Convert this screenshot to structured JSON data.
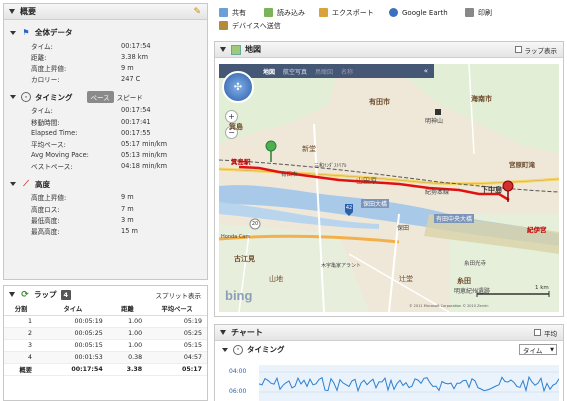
{
  "overview": {
    "title": "概要",
    "overall": {
      "title": "全体データ",
      "rows": [
        {
          "k": "タイム:",
          "v": "00:17:54"
        },
        {
          "k": "距離:",
          "v": "3.38 km"
        },
        {
          "k": "高度上昇値:",
          "v": "9 m"
        },
        {
          "k": "カロリー:",
          "v": "247 C"
        }
      ]
    },
    "timing": {
      "title": "タイミング",
      "pace_label": "ペース",
      "speed_label": "スピード",
      "rows": [
        {
          "k": "タイム:",
          "v": "00:17:54"
        },
        {
          "k": "移動時間:",
          "v": "00:17:41"
        },
        {
          "k": "Elapsed Time:",
          "v": "00:17:55"
        },
        {
          "k": "平均ペース:",
          "v": "05:17 min/km"
        },
        {
          "k": "Avg Moving Pace:",
          "v": "05:13 min/km"
        },
        {
          "k": "ベストペース:",
          "v": "04:18 min/km"
        }
      ]
    },
    "elevation": {
      "title": "高度",
      "rows": [
        {
          "k": "高度上昇値:",
          "v": "9 m"
        },
        {
          "k": "高度ロス:",
          "v": "7 m"
        },
        {
          "k": "最低高度:",
          "v": "3 m"
        },
        {
          "k": "最高高度:",
          "v": "15 m"
        }
      ]
    }
  },
  "laps": {
    "title": "ラップ",
    "count": "4",
    "split_label": "スプリット表示",
    "headers": [
      "分割",
      "タイム",
      "距離",
      "平均ペース"
    ],
    "rows": [
      [
        "1",
        "00:05:19",
        "1.00",
        "05:19"
      ],
      [
        "2",
        "00:05:25",
        "1.00",
        "05:25"
      ],
      [
        "3",
        "00:05:15",
        "1.00",
        "05:15"
      ],
      [
        "4",
        "00:01:53",
        "0.38",
        "04:57"
      ],
      [
        "概要",
        "00:17:54",
        "3.38",
        "05:17"
      ]
    ]
  },
  "toolbar": {
    "share": "共有",
    "import": "読み込み",
    "export": "エクスポート",
    "google_earth": "Google Earth",
    "print": "印刷",
    "send_device": "デバイスへ送信"
  },
  "map": {
    "title": "地図",
    "lap_display": "ラップ表示",
    "mode_tabs": [
      "地図",
      "航空写真",
      "鳥瞰図",
      "名称"
    ],
    "labels": {
      "kainan": "海南市",
      "arida_city": "有田市",
      "myojin": "明神山",
      "minoshima": "箕島",
      "shinden": "新堂",
      "minoshima_eki": "箕島駅",
      "miwa": "三和ｲﾝﾀﾞｽﾄﾘｱﾙ",
      "arida_ichi": "有田市",
      "yamadahara": "山田原",
      "kiseki": "紀勢本線",
      "miyahara": "宮原町滝",
      "shimonaka": "下中島",
      "kiikoku": "紀伊宮",
      "hoda_ohashi": "保田大橋",
      "arida_chuo": "有田中央大橋",
      "hoda": "保田",
      "honda": "Honda Cars",
      "furue": "古江見",
      "yamachi": "山地",
      "kokyu": "木宇亀家アラント",
      "tsuji": "辻堂",
      "hirose": "糸田",
      "tomida_sho": "糸田光寺",
      "ikeda": "明恵紀州遺跡",
      "road_42": "42",
      "road_20": "20",
      "scale": "1 km",
      "bing": "bing",
      "copyright": "© 2011 Microsoft Corporation © 2010 Zenrin"
    }
  },
  "chart": {
    "title": "チャート",
    "avg_label": "平均",
    "timing_title": "タイミング",
    "select_value": "タイム",
    "y_ticks": [
      "04:00",
      "06:00"
    ]
  },
  "colors": {
    "route": "#e11111",
    "pace_line": "#2b7fd1",
    "water": "#a9c9e8"
  }
}
